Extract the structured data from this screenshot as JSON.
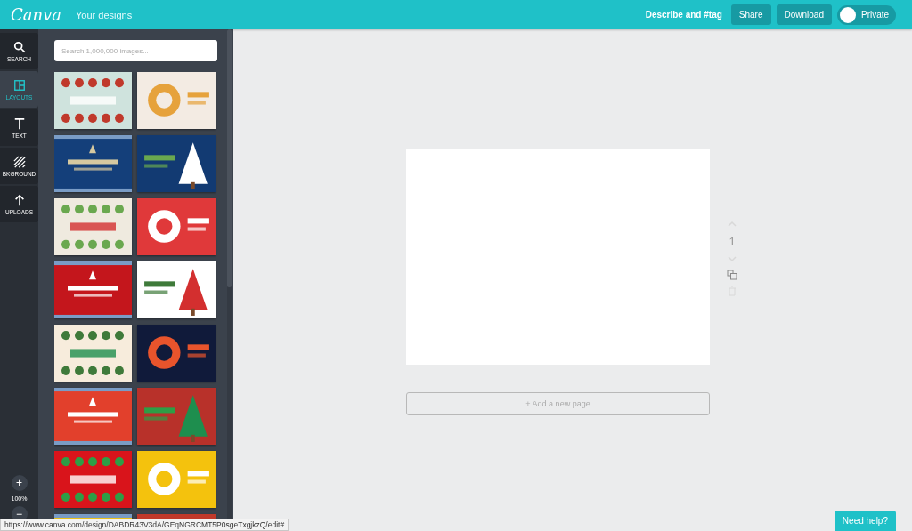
{
  "topbar": {
    "logo": "Canva",
    "title": "Your designs",
    "describe": "Describe and #tag",
    "buttons": [
      "Share",
      "Download"
    ],
    "privacy": {
      "label": "Private",
      "on": false
    }
  },
  "rail": {
    "items": [
      {
        "label": "SEARCH",
        "selected": false
      },
      {
        "label": "LAYOUTS",
        "selected": true
      },
      {
        "label": "TEXT",
        "selected": false
      },
      {
        "label": "BKGROUND",
        "selected": false
      },
      {
        "label": "UPLOADS",
        "selected": false
      }
    ],
    "zoom": {
      "plus": "+",
      "level": "100%",
      "minus": "−"
    }
  },
  "panel": {
    "search": {
      "placeholder": "Search 1,000,000 images..."
    }
  },
  "editor": {
    "page_number": "1",
    "add_page": "+ Add a new page"
  },
  "status_bar": {
    "url": "https://www.canva.com/design/DABDR43V3dA/GEqNGRCMT5P0sgeTxgjkzQ/edit#"
  },
  "help_button": "Need help?"
}
